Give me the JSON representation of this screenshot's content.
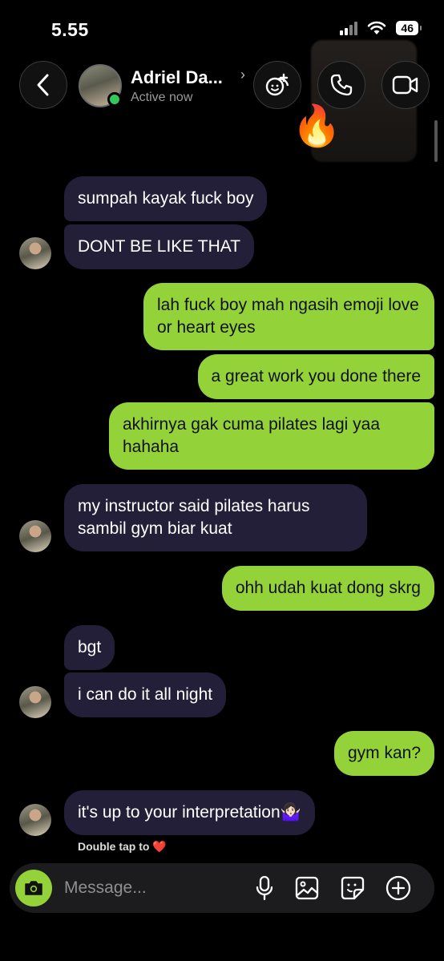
{
  "status_bar": {
    "time": "5.55",
    "battery": "46"
  },
  "header": {
    "contact_name": "Adriel Da...",
    "name_chevron": "›",
    "contact_status": "Active now",
    "fire_emoji": "🔥",
    "icons": [
      "back-arrow-icon",
      "effects-icon",
      "phone-icon",
      "video-camera-icon"
    ]
  },
  "messages": [
    {
      "side": "received",
      "text": "sumpah kayak fuck boy"
    },
    {
      "side": "received",
      "text": "DONT BE LIKE THAT"
    },
    {
      "side": "sent",
      "text": "lah fuck boy mah ngasih emoji love or heart eyes"
    },
    {
      "side": "sent",
      "text": "a great work you done there"
    },
    {
      "side": "sent",
      "text": "akhirnya gak cuma pilates lagi yaa hahaha"
    },
    {
      "side": "received",
      "text": "my instructor said pilates harus sambil gym biar kuat"
    },
    {
      "side": "sent",
      "text": "ohh udah kuat dong skrg"
    },
    {
      "side": "received",
      "text": "bgt"
    },
    {
      "side": "received",
      "text": "i can do it all night"
    },
    {
      "side": "sent",
      "text": "gym kan?"
    },
    {
      "side": "received",
      "text": "it's up to your interpretation🤷🏻‍♀️"
    }
  ],
  "double_tap_hint": "Double tap to ❤️",
  "composer": {
    "placeholder": "Message...",
    "icons": [
      "camera-icon",
      "microphone-icon",
      "gallery-icon",
      "sticker-icon",
      "plus-icon"
    ]
  },
  "colors": {
    "sent_bubble": "#94d23a",
    "received_bubble": "#241f38",
    "online": "#35c759"
  }
}
